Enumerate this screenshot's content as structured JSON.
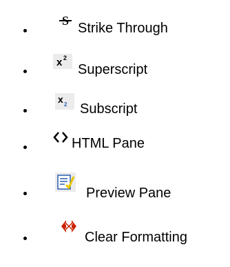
{
  "toolbar_features": {
    "items": [
      {
        "icon": "strike-through-icon",
        "label": "Strike Through"
      },
      {
        "icon": "superscript-icon",
        "label": "Superscript"
      },
      {
        "icon": "subscript-icon",
        "label": "Subscript"
      },
      {
        "icon": "html-pane-icon",
        "label": "HTML Pane"
      },
      {
        "icon": "preview-pane-icon",
        "label": "Preview Pane"
      },
      {
        "icon": "clear-formatting-icon",
        "label": "Clear Formatting"
      }
    ]
  },
  "colors": {
    "text": "#000000",
    "icon_dark": "#000000",
    "clear_formatting_red": "#cc2200",
    "icon_background": "#ececec",
    "preview_blue": "#2a5db0",
    "preview_check": "#e8c400"
  }
}
